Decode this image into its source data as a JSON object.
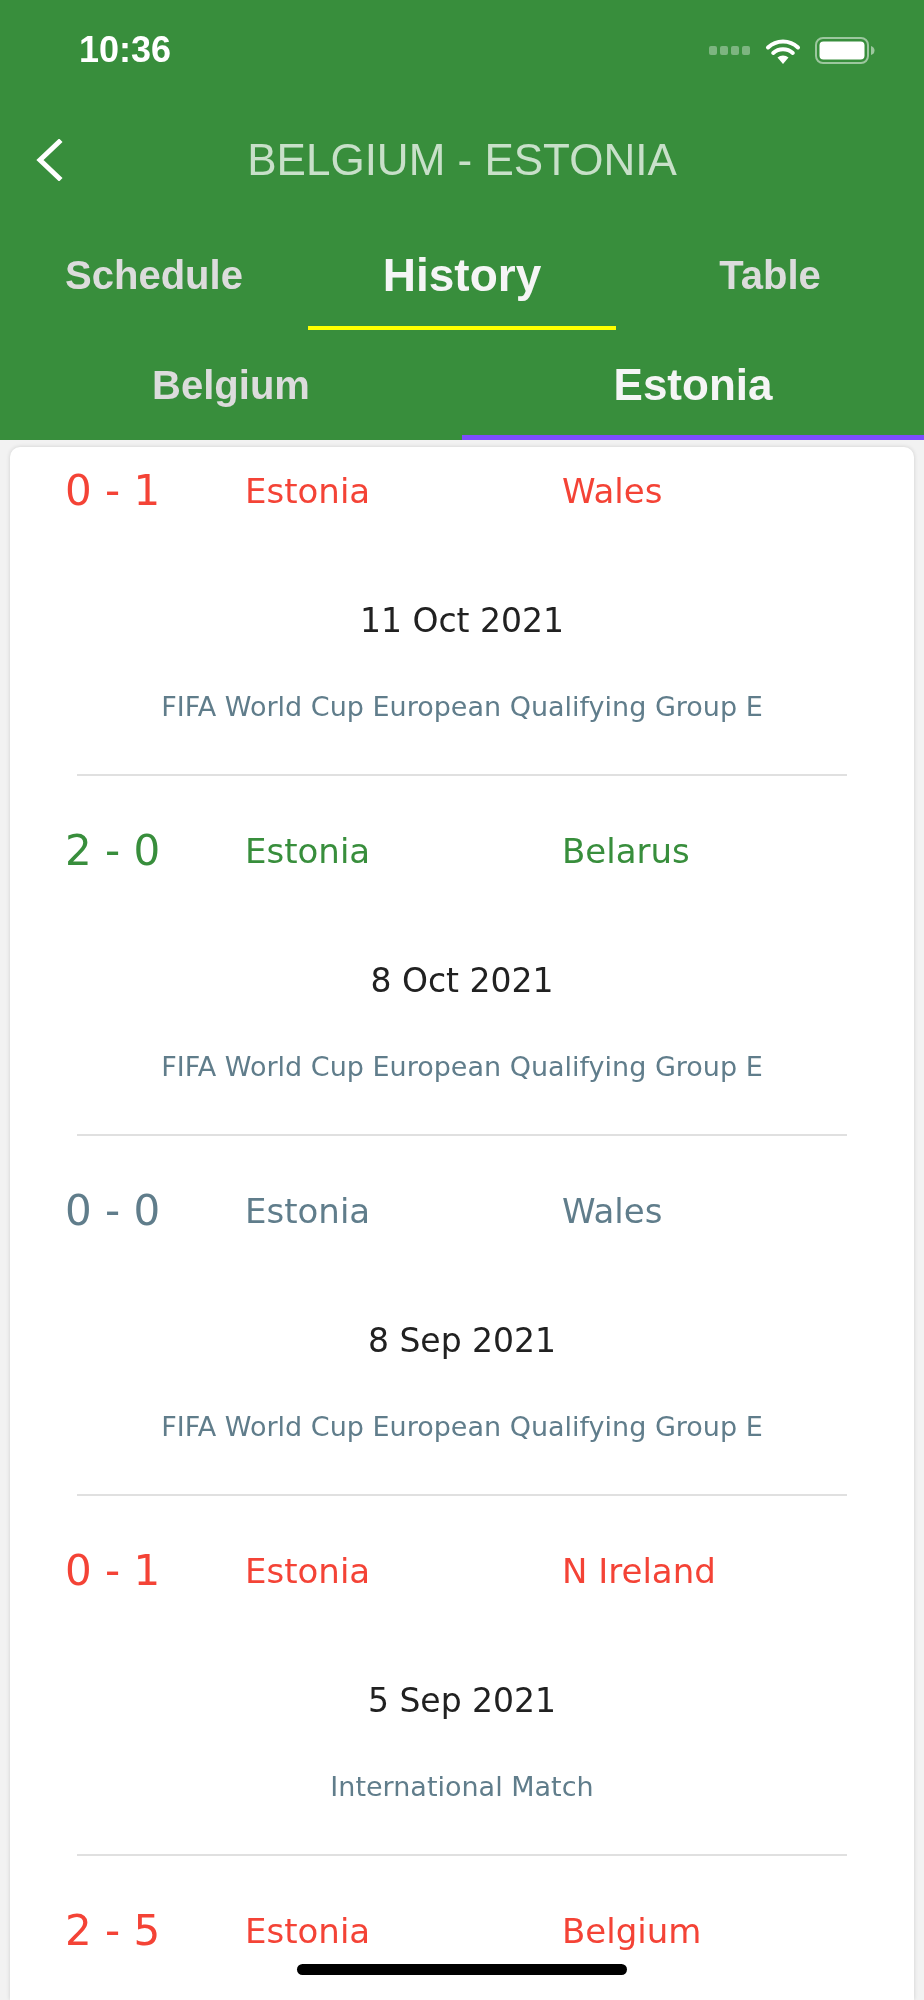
{
  "status_bar": {
    "time": "10:36"
  },
  "header": {
    "title": "BELGIUM - ESTONIA"
  },
  "tabs": [
    {
      "label": "Schedule",
      "selected": false
    },
    {
      "label": "History",
      "selected": true
    },
    {
      "label": "Table",
      "selected": false
    }
  ],
  "team_tabs": [
    {
      "label": "Belgium",
      "selected": false
    },
    {
      "label": "Estonia",
      "selected": true
    }
  ],
  "matches": [
    {
      "score": "0 - 1",
      "home": "Estonia",
      "away": "Wales",
      "color": "#f44336",
      "date": "11 Oct 2021",
      "competition": "FIFA World Cup European Qualifying Group E"
    },
    {
      "score": "2 - 0",
      "home": "Estonia",
      "away": "Belarus",
      "color": "#388e3c",
      "date": "8 Oct 2021",
      "competition": "FIFA World Cup European Qualifying Group E"
    },
    {
      "score": "0 - 0",
      "home": "Estonia",
      "away": "Wales",
      "color": "#607d8b",
      "date": "8 Sep 2021",
      "competition": "FIFA World Cup European Qualifying Group E"
    },
    {
      "score": "0 - 1",
      "home": "Estonia",
      "away": "N Ireland",
      "color": "#f44336",
      "date": "5 Sep 2021",
      "competition": "International Match"
    },
    {
      "score": "2 - 5",
      "home": "Estonia",
      "away": "Belgium",
      "color": "#f44336"
    }
  ]
}
